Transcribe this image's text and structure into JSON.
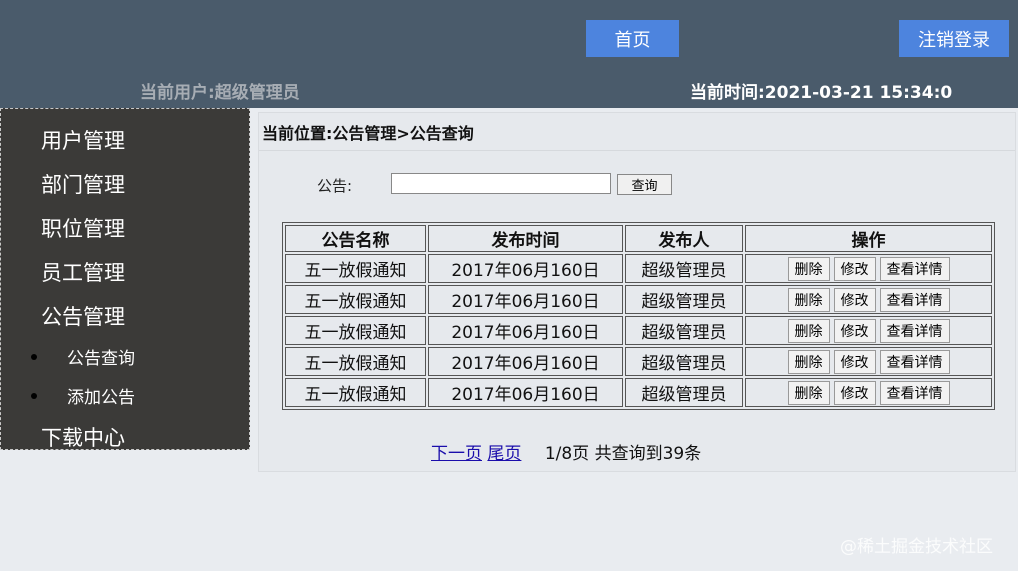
{
  "header": {
    "home_label": "首页",
    "logout_label": "注销登录",
    "current_user": "当前用户:超级管理员",
    "current_time": "当前时间:2021-03-21 15:34:0"
  },
  "sidebar": {
    "items": [
      {
        "label": "用户管理"
      },
      {
        "label": "部门管理"
      },
      {
        "label": "职位管理"
      },
      {
        "label": "员工管理"
      },
      {
        "label": "公告管理"
      },
      {
        "label": "下载中心"
      }
    ],
    "sub_items": [
      {
        "label": "公告查询"
      },
      {
        "label": "添加公告"
      }
    ]
  },
  "main": {
    "breadcrumb": "当前位置:公告管理>公告查询",
    "search": {
      "label": "公告:",
      "value": "",
      "button_label": "查询"
    },
    "table": {
      "headers": [
        "公告名称",
        "发布时间",
        "发布人",
        "操作"
      ],
      "rows": [
        {
          "name": "五一放假通知",
          "time": "2017年06月160日",
          "publisher": "超级管理员"
        },
        {
          "name": "五一放假通知",
          "time": "2017年06月160日",
          "publisher": "超级管理员"
        },
        {
          "name": "五一放假通知",
          "time": "2017年06月160日",
          "publisher": "超级管理员"
        },
        {
          "name": "五一放假通知",
          "time": "2017年06月160日",
          "publisher": "超级管理员"
        },
        {
          "name": "五一放假通知",
          "time": "2017年06月160日",
          "publisher": "超级管理员"
        }
      ],
      "actions": {
        "delete": "删除",
        "edit": "修改",
        "details": "查看详情"
      }
    },
    "pager": {
      "next_label": "下一页",
      "last_label": "尾页",
      "info": "1/8页 共查询到39条"
    }
  },
  "watermark": "@稀土掘金技术社区"
}
